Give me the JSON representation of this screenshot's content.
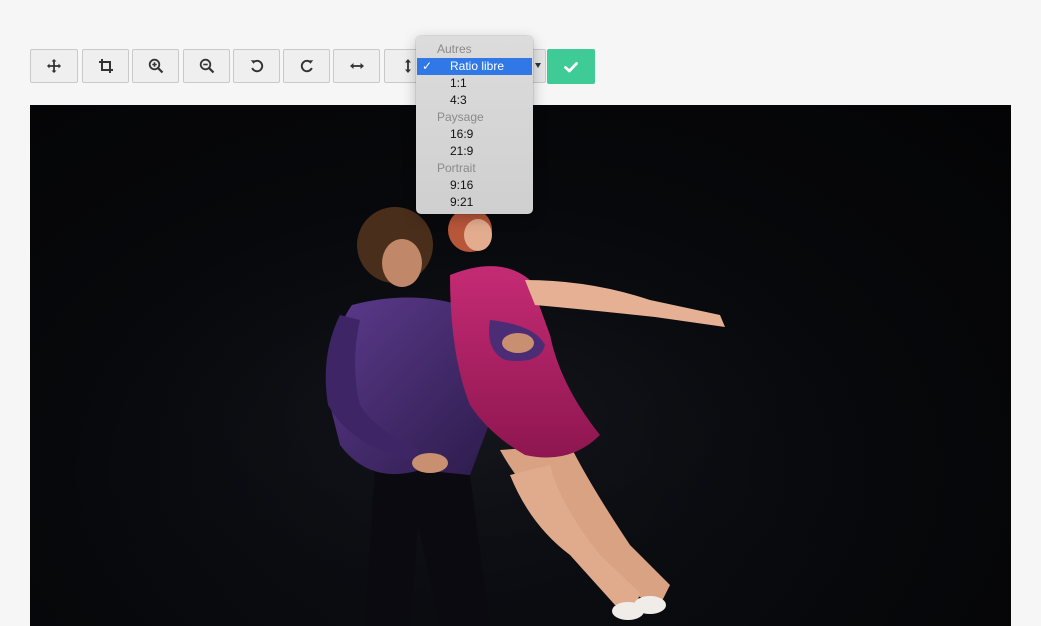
{
  "toolbar": {
    "buttons": [
      {
        "name": "move-button",
        "icon": "move-icon"
      },
      {
        "name": "crop-button",
        "icon": "crop-icon"
      },
      {
        "name": "zoom-in-button",
        "icon": "zoom-in-icon"
      },
      {
        "name": "zoom-out-button",
        "icon": "zoom-out-icon"
      },
      {
        "name": "rotate-left-button",
        "icon": "rotate-left-icon"
      },
      {
        "name": "rotate-right-button",
        "icon": "rotate-right-icon"
      },
      {
        "name": "flip-horizontal-button",
        "icon": "flip-horizontal-icon"
      },
      {
        "name": "flip-vertical-button",
        "icon": "flip-vertical-icon"
      }
    ],
    "apply_icon": "check-icon",
    "apply_color": "#3ecb96"
  },
  "ratio_menu": {
    "groups": [
      {
        "label": "Autres",
        "items": [
          {
            "label": "Ratio libre",
            "selected": true
          },
          {
            "label": "1:1",
            "selected": false
          },
          {
            "label": "4:3",
            "selected": false
          }
        ]
      },
      {
        "label": "Paysage",
        "items": [
          {
            "label": "16:9",
            "selected": false
          },
          {
            "label": "21:9",
            "selected": false
          }
        ]
      },
      {
        "label": "Portrait",
        "items": [
          {
            "label": "9:16",
            "selected": false
          },
          {
            "label": "9:21",
            "selected": false
          }
        ]
      }
    ],
    "selected_color": "#2f78e6"
  },
  "photo": {
    "subject": "two dancers on dark stage",
    "colors": {
      "background": "#050608",
      "dress": "#b8246c",
      "top": "#4b2c75"
    }
  }
}
